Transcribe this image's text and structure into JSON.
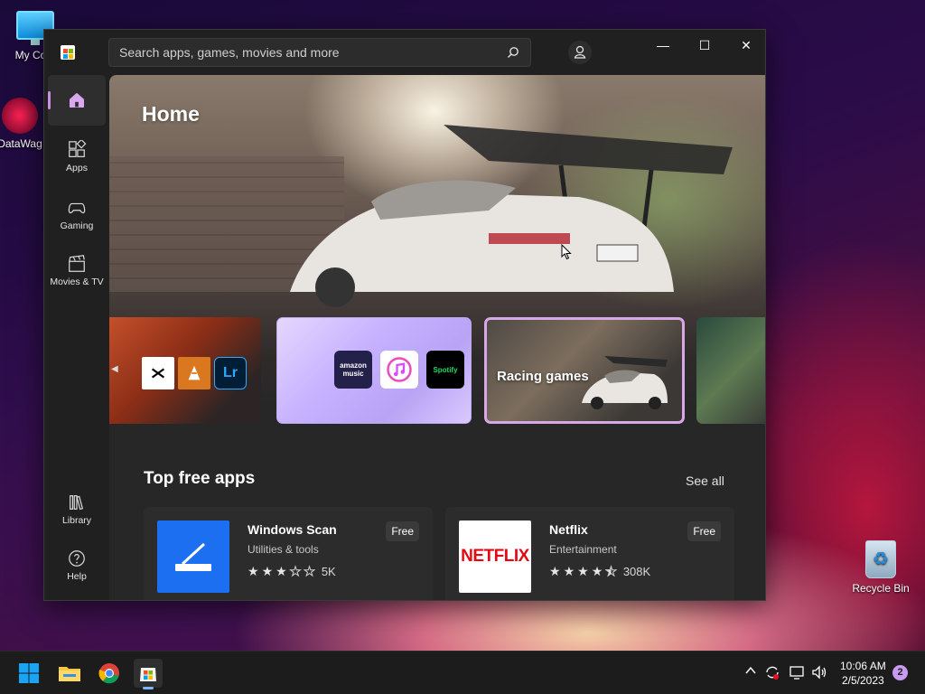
{
  "desktop": {
    "icons": [
      {
        "label": "My Com",
        "icon": "monitor-icon"
      },
      {
        "label": "DataWag",
        "icon": "datawagon-icon"
      },
      {
        "label": "Recycle Bin",
        "icon": "recycle-bin-icon"
      }
    ]
  },
  "window": {
    "search": {
      "placeholder": "Search apps, games, movies and more"
    },
    "controls": {
      "minimize": "—",
      "maximize": "☐",
      "close": "✕"
    }
  },
  "sidebar": {
    "items": [
      {
        "label": "",
        "icon": "home-icon",
        "active": true
      },
      {
        "label": "Apps",
        "icon": "apps-icon"
      },
      {
        "label": "Gaming",
        "icon": "gamepad-icon"
      },
      {
        "label": "Movies & TV",
        "icon": "clapperboard-icon"
      },
      {
        "label": "Library",
        "icon": "library-icon"
      },
      {
        "label": "Help",
        "icon": "help-icon"
      }
    ]
  },
  "hero": {
    "title": "Home",
    "cards": [
      {
        "tiles": [
          "CapCut",
          "VLC",
          "Lr"
        ]
      },
      {
        "tiles": [
          "amazon music",
          "iTunes",
          "Spotify"
        ]
      },
      {
        "title": "Racing games"
      }
    ]
  },
  "section": {
    "title": "Top free apps",
    "see_all": "See all",
    "apps": [
      {
        "name": "Windows Scan",
        "category": "Utilities & tools",
        "rating_count": "5K",
        "price": "Free",
        "stars": 3
      },
      {
        "name": "Netflix",
        "category": "Entertainment",
        "rating_count": "308K",
        "price": "Free",
        "stars": 4.5,
        "logo_text": "NETFLIX"
      }
    ]
  },
  "taskbar": {
    "apps": [
      "start-icon",
      "file-explorer-icon",
      "chrome-icon",
      "microsoft-store-icon"
    ],
    "clock_time": "10:06 AM",
    "clock_date": "2/5/2023",
    "notification_count": "2",
    "chevron": "^"
  },
  "colors": {
    "accent": "#c88ee0",
    "window_bg": "#202020",
    "card_bg": "#2c2c2c",
    "netflix_red": "#e50914",
    "scan_blue": "#1d6ff2"
  }
}
